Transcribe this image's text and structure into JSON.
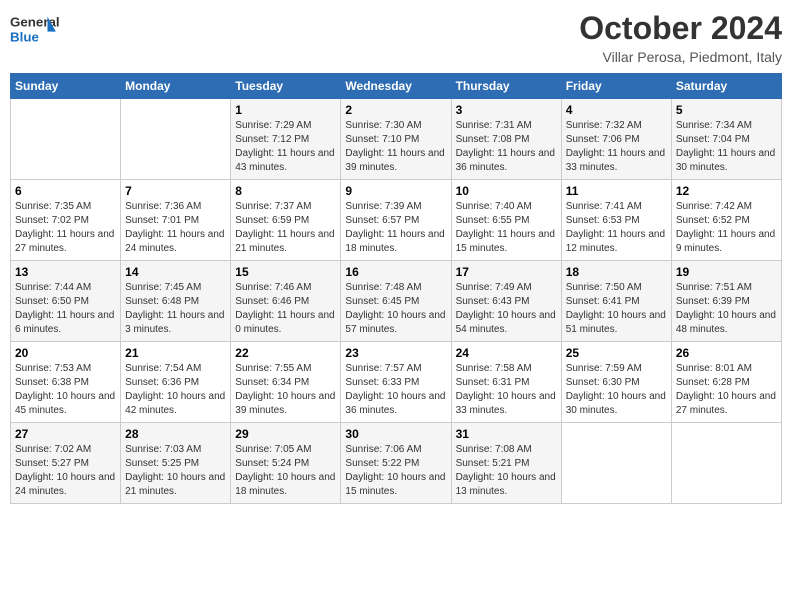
{
  "header": {
    "logo_general": "General",
    "logo_blue": "Blue",
    "month_title": "October 2024",
    "location": "Villar Perosa, Piedmont, Italy"
  },
  "weekdays": [
    "Sunday",
    "Monday",
    "Tuesday",
    "Wednesday",
    "Thursday",
    "Friday",
    "Saturday"
  ],
  "weeks": [
    [
      {
        "day": "",
        "sunrise": "",
        "sunset": "",
        "daylight": ""
      },
      {
        "day": "",
        "sunrise": "",
        "sunset": "",
        "daylight": ""
      },
      {
        "day": "1",
        "sunrise": "Sunrise: 7:29 AM",
        "sunset": "Sunset: 7:12 PM",
        "daylight": "Daylight: 11 hours and 43 minutes."
      },
      {
        "day": "2",
        "sunrise": "Sunrise: 7:30 AM",
        "sunset": "Sunset: 7:10 PM",
        "daylight": "Daylight: 11 hours and 39 minutes."
      },
      {
        "day": "3",
        "sunrise": "Sunrise: 7:31 AM",
        "sunset": "Sunset: 7:08 PM",
        "daylight": "Daylight: 11 hours and 36 minutes."
      },
      {
        "day": "4",
        "sunrise": "Sunrise: 7:32 AM",
        "sunset": "Sunset: 7:06 PM",
        "daylight": "Daylight: 11 hours and 33 minutes."
      },
      {
        "day": "5",
        "sunrise": "Sunrise: 7:34 AM",
        "sunset": "Sunset: 7:04 PM",
        "daylight": "Daylight: 11 hours and 30 minutes."
      }
    ],
    [
      {
        "day": "6",
        "sunrise": "Sunrise: 7:35 AM",
        "sunset": "Sunset: 7:02 PM",
        "daylight": "Daylight: 11 hours and 27 minutes."
      },
      {
        "day": "7",
        "sunrise": "Sunrise: 7:36 AM",
        "sunset": "Sunset: 7:01 PM",
        "daylight": "Daylight: 11 hours and 24 minutes."
      },
      {
        "day": "8",
        "sunrise": "Sunrise: 7:37 AM",
        "sunset": "Sunset: 6:59 PM",
        "daylight": "Daylight: 11 hours and 21 minutes."
      },
      {
        "day": "9",
        "sunrise": "Sunrise: 7:39 AM",
        "sunset": "Sunset: 6:57 PM",
        "daylight": "Daylight: 11 hours and 18 minutes."
      },
      {
        "day": "10",
        "sunrise": "Sunrise: 7:40 AM",
        "sunset": "Sunset: 6:55 PM",
        "daylight": "Daylight: 11 hours and 15 minutes."
      },
      {
        "day": "11",
        "sunrise": "Sunrise: 7:41 AM",
        "sunset": "Sunset: 6:53 PM",
        "daylight": "Daylight: 11 hours and 12 minutes."
      },
      {
        "day": "12",
        "sunrise": "Sunrise: 7:42 AM",
        "sunset": "Sunset: 6:52 PM",
        "daylight": "Daylight: 11 hours and 9 minutes."
      }
    ],
    [
      {
        "day": "13",
        "sunrise": "Sunrise: 7:44 AM",
        "sunset": "Sunset: 6:50 PM",
        "daylight": "Daylight: 11 hours and 6 minutes."
      },
      {
        "day": "14",
        "sunrise": "Sunrise: 7:45 AM",
        "sunset": "Sunset: 6:48 PM",
        "daylight": "Daylight: 11 hours and 3 minutes."
      },
      {
        "day": "15",
        "sunrise": "Sunrise: 7:46 AM",
        "sunset": "Sunset: 6:46 PM",
        "daylight": "Daylight: 11 hours and 0 minutes."
      },
      {
        "day": "16",
        "sunrise": "Sunrise: 7:48 AM",
        "sunset": "Sunset: 6:45 PM",
        "daylight": "Daylight: 10 hours and 57 minutes."
      },
      {
        "day": "17",
        "sunrise": "Sunrise: 7:49 AM",
        "sunset": "Sunset: 6:43 PM",
        "daylight": "Daylight: 10 hours and 54 minutes."
      },
      {
        "day": "18",
        "sunrise": "Sunrise: 7:50 AM",
        "sunset": "Sunset: 6:41 PM",
        "daylight": "Daylight: 10 hours and 51 minutes."
      },
      {
        "day": "19",
        "sunrise": "Sunrise: 7:51 AM",
        "sunset": "Sunset: 6:39 PM",
        "daylight": "Daylight: 10 hours and 48 minutes."
      }
    ],
    [
      {
        "day": "20",
        "sunrise": "Sunrise: 7:53 AM",
        "sunset": "Sunset: 6:38 PM",
        "daylight": "Daylight: 10 hours and 45 minutes."
      },
      {
        "day": "21",
        "sunrise": "Sunrise: 7:54 AM",
        "sunset": "Sunset: 6:36 PM",
        "daylight": "Daylight: 10 hours and 42 minutes."
      },
      {
        "day": "22",
        "sunrise": "Sunrise: 7:55 AM",
        "sunset": "Sunset: 6:34 PM",
        "daylight": "Daylight: 10 hours and 39 minutes."
      },
      {
        "day": "23",
        "sunrise": "Sunrise: 7:57 AM",
        "sunset": "Sunset: 6:33 PM",
        "daylight": "Daylight: 10 hours and 36 minutes."
      },
      {
        "day": "24",
        "sunrise": "Sunrise: 7:58 AM",
        "sunset": "Sunset: 6:31 PM",
        "daylight": "Daylight: 10 hours and 33 minutes."
      },
      {
        "day": "25",
        "sunrise": "Sunrise: 7:59 AM",
        "sunset": "Sunset: 6:30 PM",
        "daylight": "Daylight: 10 hours and 30 minutes."
      },
      {
        "day": "26",
        "sunrise": "Sunrise: 8:01 AM",
        "sunset": "Sunset: 6:28 PM",
        "daylight": "Daylight: 10 hours and 27 minutes."
      }
    ],
    [
      {
        "day": "27",
        "sunrise": "Sunrise: 7:02 AM",
        "sunset": "Sunset: 5:27 PM",
        "daylight": "Daylight: 10 hours and 24 minutes."
      },
      {
        "day": "28",
        "sunrise": "Sunrise: 7:03 AM",
        "sunset": "Sunset: 5:25 PM",
        "daylight": "Daylight: 10 hours and 21 minutes."
      },
      {
        "day": "29",
        "sunrise": "Sunrise: 7:05 AM",
        "sunset": "Sunset: 5:24 PM",
        "daylight": "Daylight: 10 hours and 18 minutes."
      },
      {
        "day": "30",
        "sunrise": "Sunrise: 7:06 AM",
        "sunset": "Sunset: 5:22 PM",
        "daylight": "Daylight: 10 hours and 15 minutes."
      },
      {
        "day": "31",
        "sunrise": "Sunrise: 7:08 AM",
        "sunset": "Sunset: 5:21 PM",
        "daylight": "Daylight: 10 hours and 13 minutes."
      },
      {
        "day": "",
        "sunrise": "",
        "sunset": "",
        "daylight": ""
      },
      {
        "day": "",
        "sunrise": "",
        "sunset": "",
        "daylight": ""
      }
    ]
  ]
}
